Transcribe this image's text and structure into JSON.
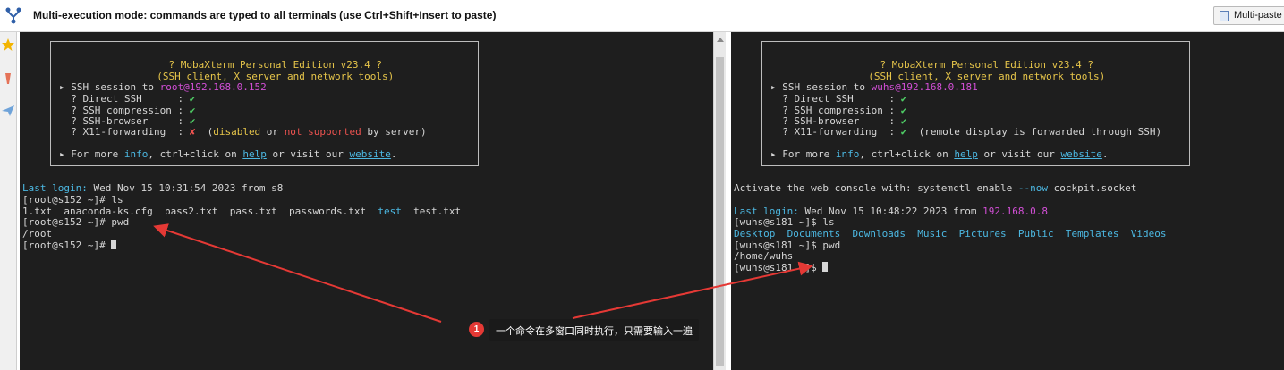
{
  "toolbar": {
    "title": "Multi-execution mode: commands are typed to all terminals (use Ctrl+Shift+Insert to paste)",
    "multipaste_label": "Multi-paste"
  },
  "left_terminal": {
    "banner": {
      "line1": "? MobaXterm Personal Edition v23.4 ?",
      "line2": "(SSH client, X server and network tools)",
      "session_prefix": "▸ SSH session to ",
      "session_target": "root@192.168.0.152",
      "direct_ssh": "  ? Direct SSH      : ",
      "ssh_compression": "  ? SSH compression : ",
      "ssh_browser": "  ? SSH-browser     : ",
      "x11": "  ? X11-forwarding  : ",
      "check": "✔",
      "cross": "✘",
      "x11_note_1": "  (",
      "x11_disabled": "disabled",
      "x11_or": " or ",
      "x11_not_supported": "not supported",
      "x11_note_2": " by server)",
      "more_prefix": "▸ For more ",
      "more_info": "info",
      "more_mid": ", ctrl+click on ",
      "more_help": "help",
      "more_mid2": " or visit our ",
      "more_website": "website",
      "more_end": "."
    },
    "last_login_label": "Last login:",
    "last_login_value": " Wed Nov 15 10:31:54 2023 from s8",
    "prompt1": "[root@s152 ~]# ls",
    "ls_files": "1.txt  anaconda-ks.cfg  pass2.txt  pass.txt  passwords.txt  ",
    "ls_dir": "test",
    "ls_last": "  test.txt",
    "prompt2": "[root@s152 ~]# pwd",
    "pwd_output": "/root",
    "prompt3": "[root@s152 ~]# "
  },
  "right_terminal": {
    "banner": {
      "line1": "? MobaXterm Personal Edition v23.4 ?",
      "line2": "(SSH client, X server and network tools)",
      "session_prefix": "▸ SSH session to ",
      "session_target": "wuhs@192.168.0.181",
      "direct_ssh": "  ? Direct SSH      : ",
      "ssh_compression": "  ? SSH compression : ",
      "ssh_browser": "  ? SSH-browser     : ",
      "x11": "  ? X11-forwarding  : ",
      "check": "✔",
      "x11_note": "  (remote display is forwarded through SSH)",
      "more_prefix": "▸ For more ",
      "more_info": "info",
      "more_mid": ", ctrl+click on ",
      "more_help": "help",
      "more_mid2": " or visit our ",
      "more_website": "website",
      "more_end": "."
    },
    "activate_prefix": "Activate the web console with: systemctl enable ",
    "activate_flag": "--now",
    "activate_suffix": " cockpit.socket",
    "last_login_label": "Last login:",
    "last_login_value": " Wed Nov 15 10:48:22 2023 from ",
    "last_login_ip": "192.168.0.8",
    "prompt1": "[wuhs@s181 ~]$ ls",
    "ls_dirs": "Desktop  Documents  Downloads  Music  Pictures  Public  Templates  Videos",
    "prompt2": "[wuhs@s181 ~]$ pwd",
    "pwd_output": "/home/wuhs",
    "prompt3": "[wuhs@s181 ~]$ "
  },
  "annotation": {
    "badge": "1",
    "text": "一个命令在多窗口同时执行，只需要输入一遍",
    "arrow_color": "#e53935"
  },
  "colors": {
    "terminal_bg": "#1e1e1e",
    "text": "#d6d6d6",
    "yellow": "#e6c54a",
    "magenta": "#d24fd6",
    "cyan": "#4cb8e2",
    "red": "#ef5350",
    "green": "#4fcf66"
  },
  "icons": [
    "fork-icon",
    "star-icon",
    "tool-icon",
    "send-icon",
    "clipboard-icon"
  ]
}
